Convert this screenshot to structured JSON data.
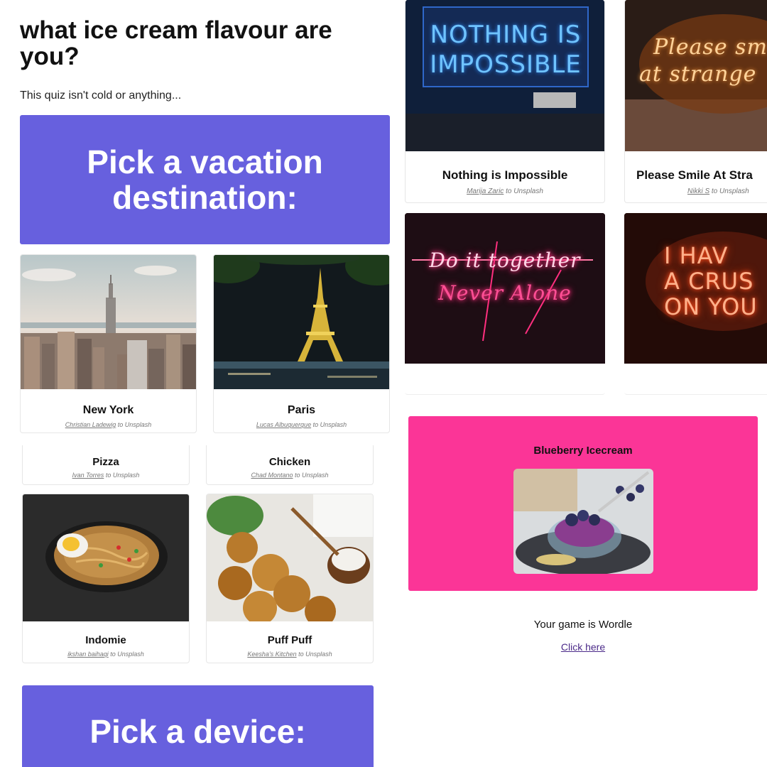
{
  "quiz": {
    "title": "what ice cream flavour are you?",
    "subtitle": "This quiz isn't cold or anything..."
  },
  "section1": {
    "heading_line1": "Pick a vacation",
    "heading_line2": "destination:"
  },
  "destinations": [
    {
      "name": "New York",
      "author": "Christian Ladewig",
      "joiner": "to",
      "source": "Unsplash"
    },
    {
      "name": "Paris",
      "author": "Lucas Albuquerque",
      "joiner": "to",
      "source": "Unsplash"
    }
  ],
  "foods_top": [
    {
      "name": "Pizza",
      "author": "Ivan Torres",
      "joiner": "to",
      "source": "Unsplash"
    },
    {
      "name": "Chicken",
      "author": "Chad Montano",
      "joiner": "to",
      "source": "Unsplash"
    }
  ],
  "foods": [
    {
      "name": "Indomie",
      "author": "ikshan baihaqi",
      "joiner": "to",
      "source": "Unsplash"
    },
    {
      "name": "Puff Puff",
      "author": "Keesha's Kitchen",
      "joiner": "to",
      "source": "Unsplash"
    }
  ],
  "section2": {
    "heading": "Pick a device:"
  },
  "signs": [
    {
      "name": "Nothing is Impossible",
      "author": "Marija Zaric",
      "joiner": "to",
      "source": "Unsplash",
      "neon_line1": "NOTHING IS",
      "neon_line2": "IMPOSSIBLE"
    },
    {
      "name": "Please Smile At Stra",
      "author": "Nikki S",
      "joiner": "to",
      "source": "Unsplash",
      "neon_line1": "Please sm",
      "neon_line2": "at strange"
    },
    {
      "neon_line1": "Do it together",
      "neon_line2": "Never Alone"
    },
    {
      "neon_line1": "I HAV",
      "neon_line2": "A CRUS",
      "neon_line3": "ON YOU"
    }
  ],
  "result": {
    "title": "Blueberry Icecream",
    "game_text": "Your game is Wordle",
    "link_text": "Click here"
  },
  "colors": {
    "banner": "#6760de",
    "result": "#fb3597",
    "link": "#4b2a89"
  }
}
